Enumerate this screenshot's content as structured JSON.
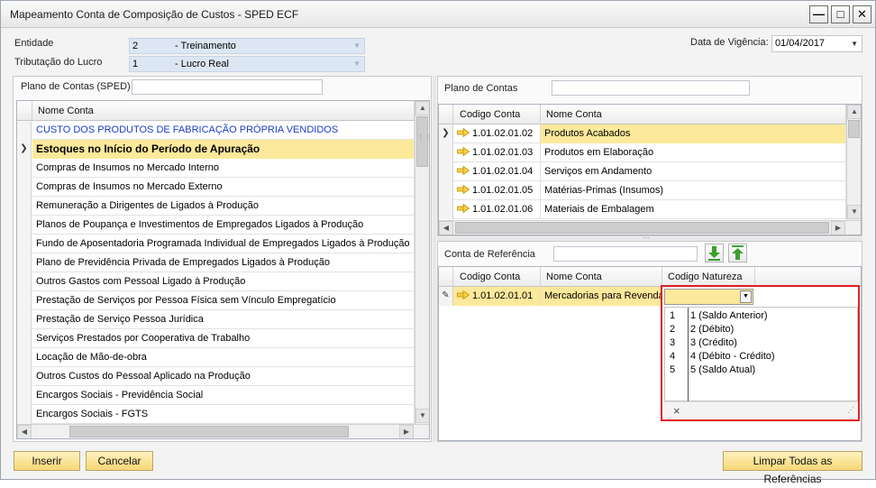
{
  "window": {
    "title": "Mapeamento Conta de Composição de Custos - SPED ECF",
    "minimize": "—",
    "maximize": "□",
    "close": "✕"
  },
  "header": {
    "entidade_label": "Entidade",
    "entidade_code": "2",
    "entidade_name": "- Treinamento",
    "tributacao_label": "Tributação do Lucro",
    "tributacao_code": "1",
    "tributacao_name": "- Lucro Real",
    "data_vigencia_label": "Data de Vigência:",
    "data_vigencia_value": "01/04/2017"
  },
  "left_panel": {
    "filter_label": "Plano de Contas (SPED)",
    "filter_value": "",
    "column_header": "Nome Conta",
    "rows": [
      "CUSTO DOS PRODUTOS DE FABRICAÇÃO PRÓPRIA VENDIDOS",
      "Estoques no Início do Período de Apuração",
      "Compras de Insumos no Mercado Interno",
      "Compras de Insumos no Mercado Externo",
      "Remuneração a Dirigentes de Ligados à Produção",
      "Planos de Poupança e Investimentos de Empregados Ligados à Produção",
      "Fundo de Aposentadoria Programada Individual de Empregados Ligados à Produção",
      "Plano de Previdência Privada de Empregados Ligados à Produção",
      "Outros Gastos com Pessoal Ligado à Produção",
      "Prestação de Serviços por Pessoa Física sem Vínculo Empregatício",
      "Prestação de Serviço Pessoa Jurídica",
      "Serviços Prestados por Cooperativa de Trabalho",
      "Locação de Mão-de-obra",
      "Outros Custos do Pessoal Aplicado na Produção",
      "Encargos Sociais - Previdência Social",
      "Encargos Sociais - FGTS"
    ],
    "selected_row_marker": "❯"
  },
  "right_top": {
    "filter_label": "Plano de Contas",
    "filter_value": "",
    "headers": {
      "code": "Codigo Conta",
      "name": "Nome Conta"
    },
    "rows": [
      {
        "code": "1.01.02.01.02",
        "name": "Produtos Acabados"
      },
      {
        "code": "1.01.02.01.03",
        "name": "Produtos em Elaboração"
      },
      {
        "code": "1.01.02.01.04",
        "name": "Serviços em Andamento"
      },
      {
        "code": "1.01.02.01.05",
        "name": "Matérias-Primas (Insumos)"
      },
      {
        "code": "1.01.02.01.06",
        "name": "Materiais de Embalagem"
      }
    ],
    "selected_row_marker": "❯"
  },
  "right_bottom": {
    "filter_label": "Conta de Referência",
    "filter_value": "",
    "headers": {
      "code": "Codigo Conta",
      "name": "Nome Conta",
      "natureza": "Codigo Natureza"
    },
    "rows": [
      {
        "code": "1.01.02.01.01",
        "name": "Mercadorias para Revenda",
        "natureza": ""
      }
    ],
    "edit_marker": "✎"
  },
  "natureza_dropdown": {
    "options": [
      {
        "key": "1",
        "value": "1 (Saldo Anterior)"
      },
      {
        "key": "2",
        "value": "2 (Débito)"
      },
      {
        "key": "3",
        "value": "3 (Crédito)"
      },
      {
        "key": "4",
        "value": "4 (Débito - Crédito)"
      },
      {
        "key": "5",
        "value": "5 (Saldo Atual)"
      }
    ],
    "clear_symbol": "×"
  },
  "footer": {
    "inserir_label": "Inserir",
    "cancelar_label": "Cancelar",
    "limpar_label": "Limpar Todas as Referências"
  },
  "colors": {
    "selection": "#fde99b",
    "highlight_border": "#e02020",
    "link_blue": "#1a3cc8",
    "arrow_gold": "#e8b400",
    "green_icon": "#3aa12f"
  }
}
